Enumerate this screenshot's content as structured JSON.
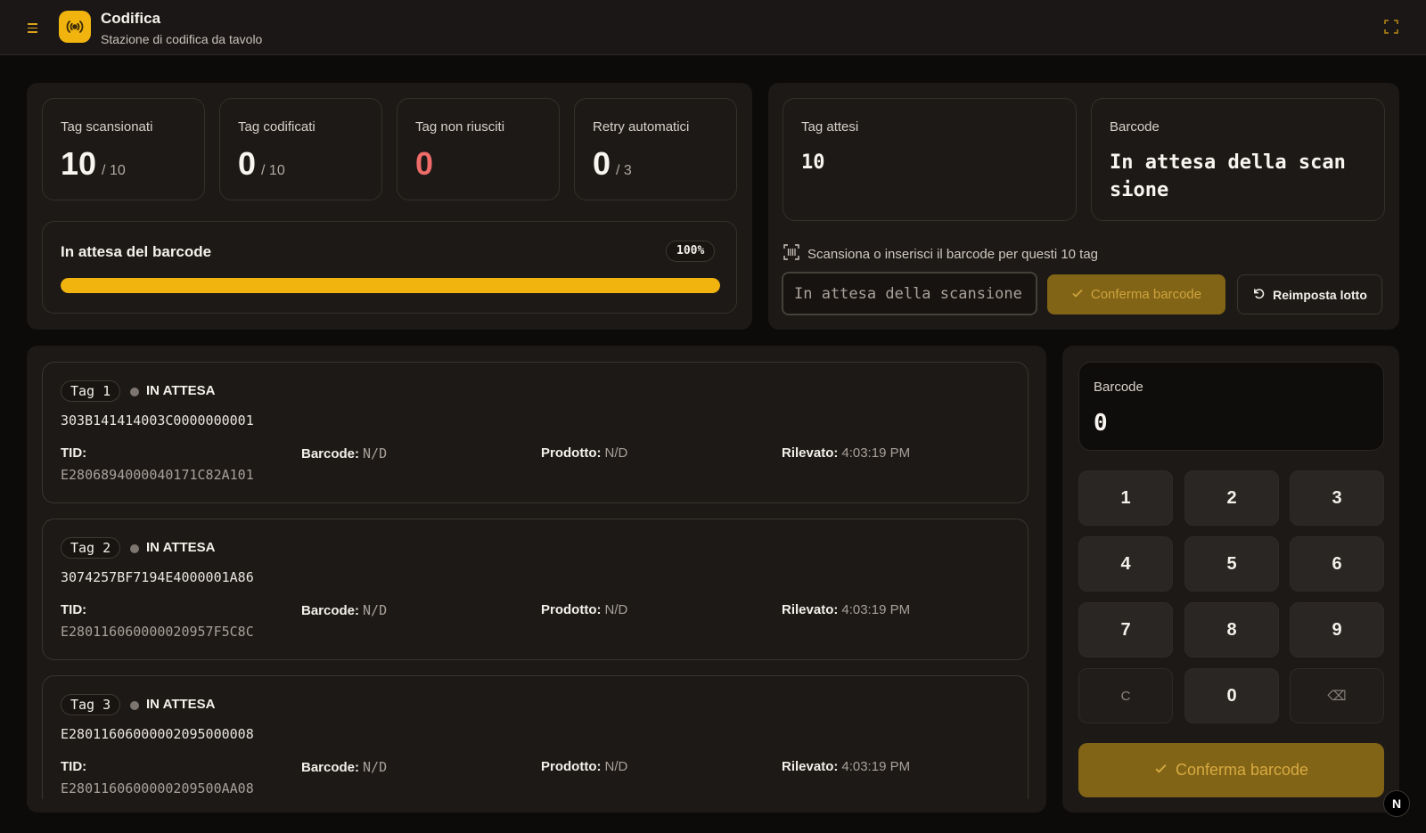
{
  "header": {
    "title": "Codifica",
    "subtitle": "Stazione di codifica da tavolo",
    "logo_icon": "broadcast-icon",
    "menu_icon": "hamburger-icon",
    "fullscreen_icon": "fullscreen-icon"
  },
  "colors": {
    "accent": "#f1b40f",
    "danger": "#ef6b68",
    "background": "#0c0b0a",
    "panel": "#1c1917"
  },
  "stats": [
    {
      "label": "Tag scansionati",
      "value": "10",
      "total": "/ 10"
    },
    {
      "label": "Tag codificati",
      "value": "0",
      "total": "/ 10"
    },
    {
      "label": "Tag non riusciti",
      "value": "0",
      "total": ""
    },
    {
      "label": "Retry automatici",
      "value": "0",
      "total": "/ 3"
    }
  ],
  "progress": {
    "title": "In attesa del barcode",
    "percent_label": "100%",
    "percent": 100
  },
  "batch": {
    "expected_label": "Tag attesi",
    "expected_value": "10",
    "barcode_label": "Barcode",
    "barcode_value": "In attesa della scan\nsione",
    "hint": "Scansiona o inserisci il barcode per questi 10 tag",
    "input_placeholder": "In attesa della scansione",
    "confirm_label": "Conferma barcode",
    "reset_label": "Reimposta lotto"
  },
  "tags": [
    {
      "pill": "Tag 1",
      "status": "IN ATTESA",
      "epc": "303B141414003C0000000001",
      "tid_label": "TID:",
      "tid": "E2806894000040171C82A101",
      "barcode_label": "Barcode:",
      "barcode": "N/D",
      "product_label": "Prodotto:",
      "product": "N/D",
      "detected_label": "Rilevato:",
      "detected": "4:03:19 PM"
    },
    {
      "pill": "Tag 2",
      "status": "IN ATTESA",
      "epc": "3074257BF7194E4000001A86",
      "tid_label": "TID:",
      "tid": "E280116060000020957F5C8C",
      "barcode_label": "Barcode:",
      "barcode": "N/D",
      "product_label": "Prodotto:",
      "product": "N/D",
      "detected_label": "Rilevato:",
      "detected": "4:03:19 PM"
    },
    {
      "pill": "Tag 3",
      "status": "IN ATTESA",
      "epc": "E28011606000002095000008",
      "tid_label": "TID:",
      "tid": "E2801160600000209500AA08",
      "barcode_label": "Barcode:",
      "barcode": "N/D",
      "product_label": "Prodotto:",
      "product": "N/D",
      "detected_label": "Rilevato:",
      "detected": "4:03:19 PM"
    }
  ],
  "keypad": {
    "display_label": "Barcode",
    "display_value": "0",
    "keys": [
      "1",
      "2",
      "3",
      "4",
      "5",
      "6",
      "7",
      "8",
      "9",
      "C",
      "0",
      "⌫"
    ],
    "confirm_label": "Conferma barcode"
  },
  "corner_badge": "N"
}
